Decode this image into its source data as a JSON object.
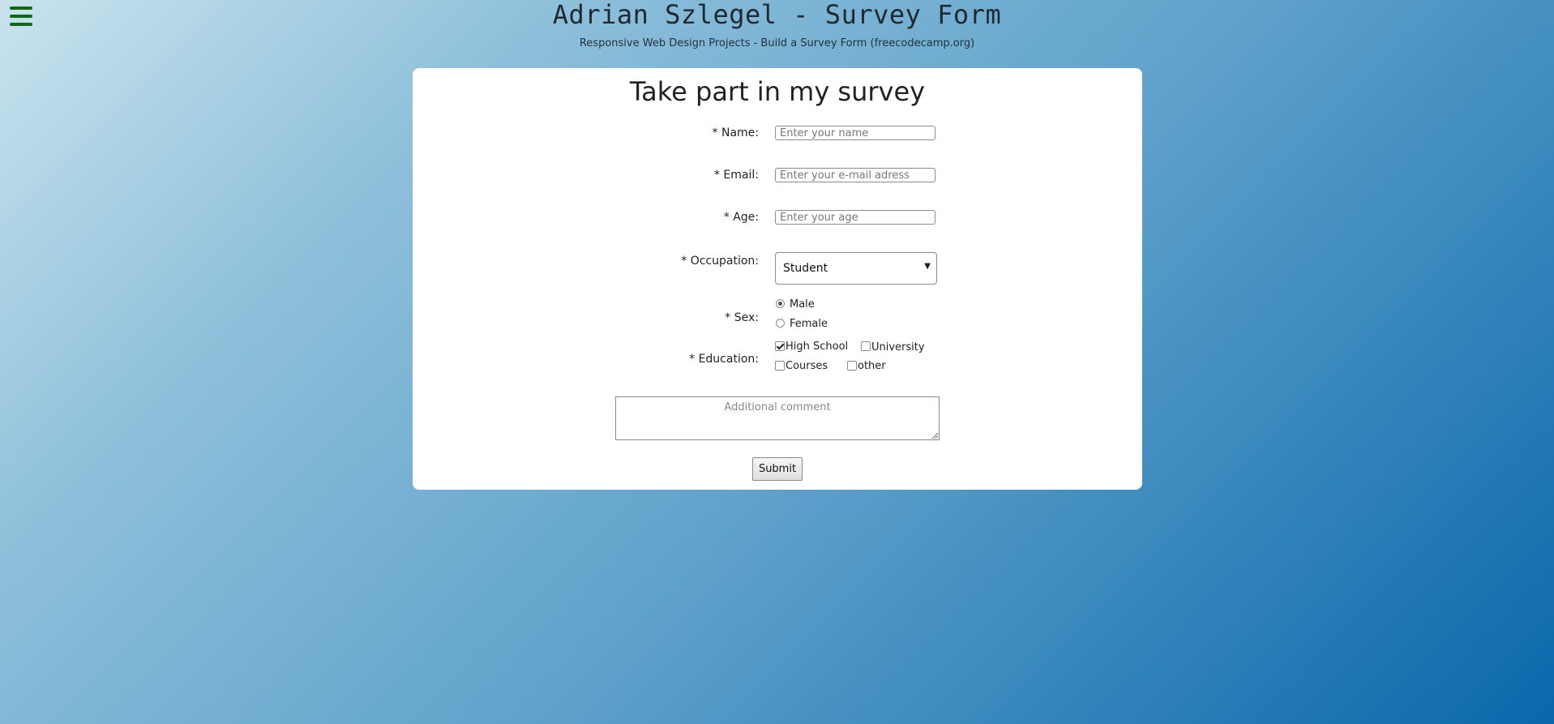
{
  "header": {
    "menu_icon": "hamburger-menu-icon",
    "title": "Adrian Szlegel - Survey Form",
    "subtitle": "Responsive Web Design Projects - Build a Survey Form (freecodecamp.org)"
  },
  "form": {
    "title": "Take part in my survey",
    "fields": {
      "name": {
        "label": "* Name:",
        "placeholder": "Enter your name",
        "value": ""
      },
      "email": {
        "label": "* Email:",
        "placeholder": "Enter your e-mail adress",
        "value": ""
      },
      "age": {
        "label": "* Age:",
        "placeholder": "Enter your age",
        "value": ""
      },
      "occupation": {
        "label": "* Occupation:",
        "selected": "Student"
      },
      "sex": {
        "label": "* Sex:",
        "options": [
          {
            "label": "Male",
            "checked": true
          },
          {
            "label": "Female",
            "checked": false
          }
        ]
      },
      "education": {
        "label": "* Education:",
        "options": [
          {
            "label": "High School",
            "checked": true
          },
          {
            "label": "University",
            "checked": false
          },
          {
            "label": "Courses",
            "checked": false
          },
          {
            "label": "other",
            "checked": false
          }
        ]
      },
      "comment": {
        "placeholder": "Additional comment",
        "value": ""
      }
    },
    "submit_label": "Submit"
  },
  "colors": {
    "menu_icon": "#0f6a0f",
    "background_start": "#c9e3ee",
    "background_end": "#0a67ab",
    "card": "#ffffff"
  }
}
